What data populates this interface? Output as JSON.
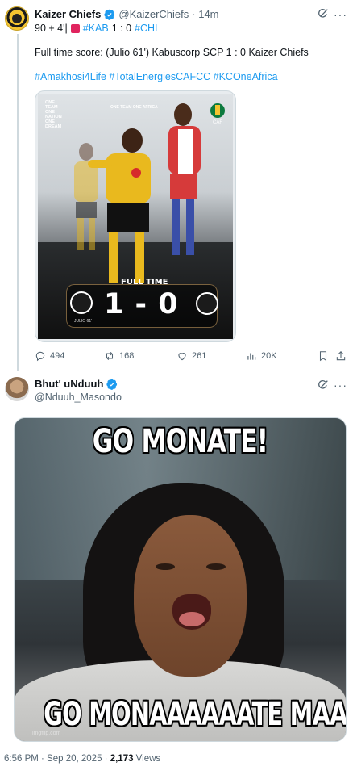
{
  "tweet1": {
    "author_name": "Kaizer Chiefs",
    "handle": "@KaizerChiefs",
    "time": "· 14m",
    "line1_prefix": "90 + 4'|",
    "line1_tag_home": "#KAB",
    "line1_score": "1 : 0",
    "line1_tag_away": "#CHI",
    "body": "Full time score: (Julio 61') Kabuscorp SCP 1 : 0 Kaizer Chiefs",
    "hashtags": "#Amakhosi4Life #TotalEnergiesCAFCC #KCOneAfrica",
    "media": {
      "side_text": "ONE TEAM ONE NATION ONE DREAM",
      "top_text": "ONE TEAM ONE AFRICA",
      "full_time": "FULL TIME",
      "score": "1 - 0",
      "scorer": "JULIO 61'"
    },
    "actions": {
      "replies": "494",
      "reposts": "168",
      "likes": "261",
      "views": "20K"
    }
  },
  "tweet2": {
    "author_name": "Bhut' uNduuh",
    "handle": "@Nduuh_Masondo",
    "meme": {
      "top_text": "GO MONATE!",
      "bottom_text": "GO MONAAAAAATE MAAN!",
      "watermark": "imgflip.com"
    },
    "footer": {
      "timestamp": "6:56 PM · Sep 20, 2025 · ",
      "views_count": "2,173",
      "views_label": " Views"
    }
  },
  "colors": {
    "accent": "#1d9bf0",
    "muted": "#536471",
    "text": "#0f1419",
    "divider": "#cfd9de"
  }
}
